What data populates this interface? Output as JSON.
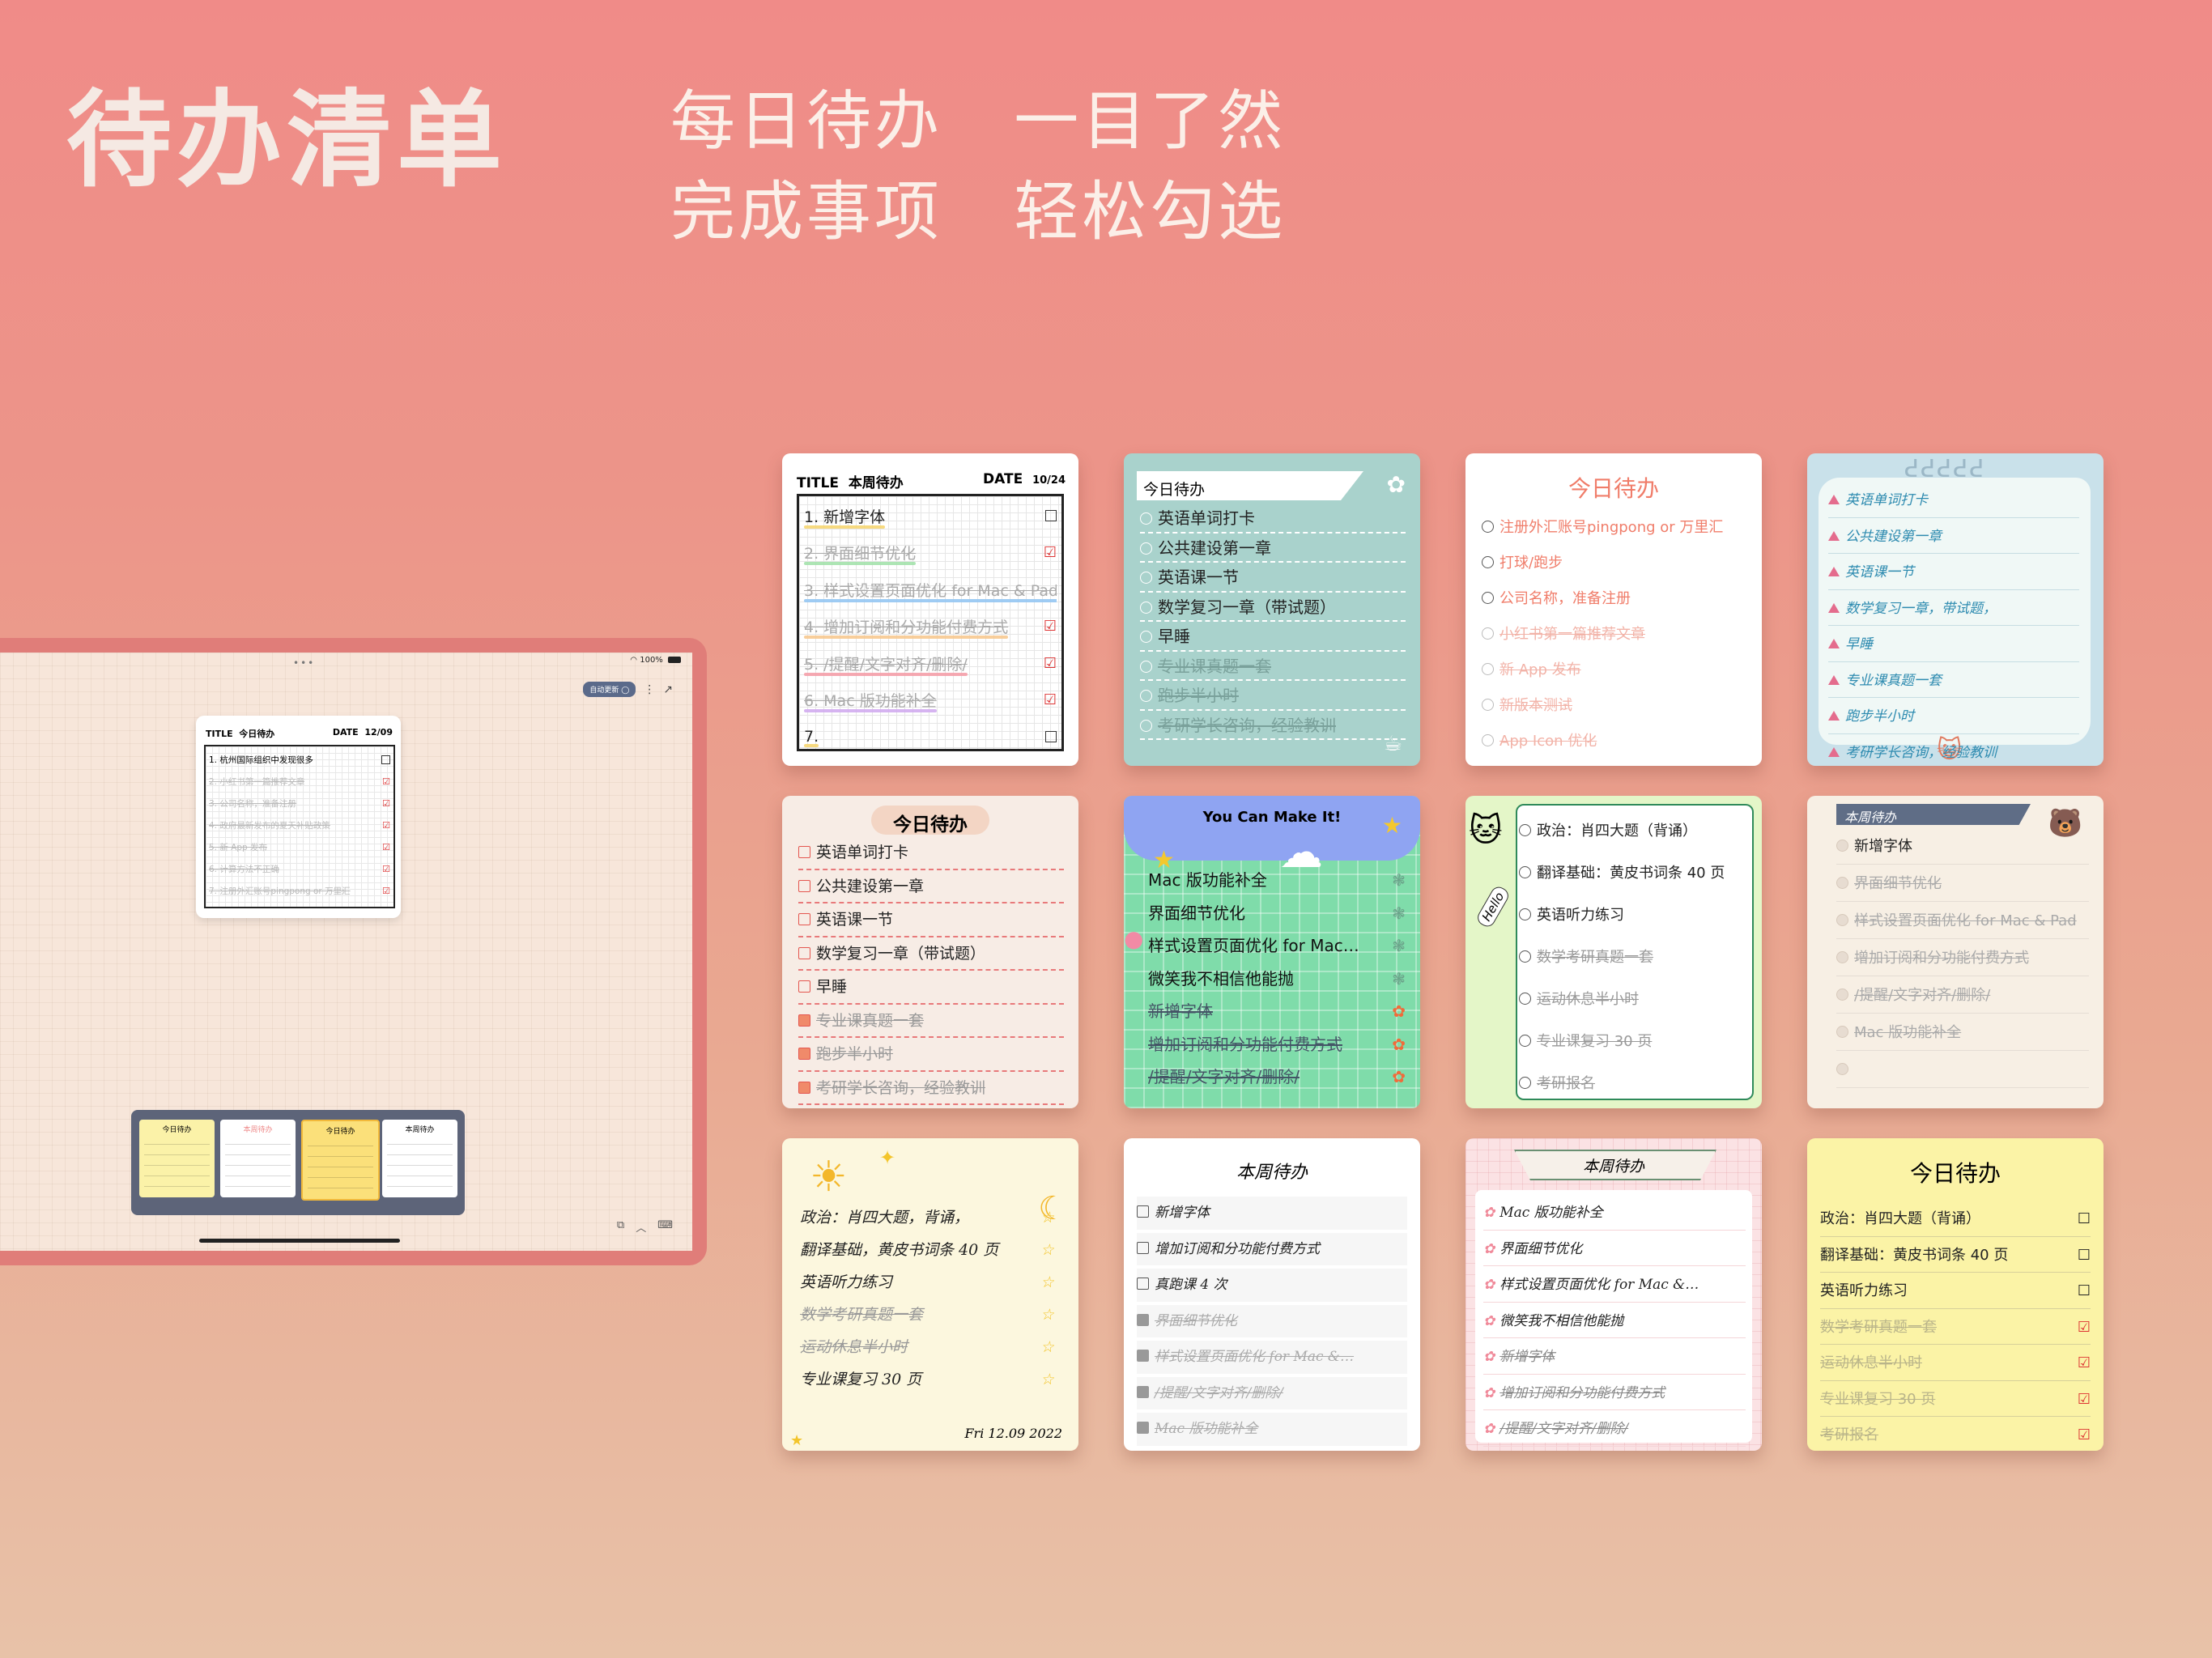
{
  "header": {
    "title": "待办清单",
    "slogan_line1": "每日待办   一目了然",
    "slogan_line2": "完成事项   轻松勾选"
  },
  "tablet": {
    "dots": "•••",
    "battery": "100%",
    "auto_update_label": "自动更新",
    "mini_note": {
      "title_label": "TITLE",
      "title": "今日待办",
      "date_label": "DATE",
      "date": "12/09",
      "items": [
        {
          "text": "1. 杭州国际组织中发现很多",
          "done": false
        },
        {
          "text": "2. 小红书第一篇推荐文章",
          "done": true
        },
        {
          "text": "3. 公司名称，准备注册",
          "done": true
        },
        {
          "text": "4. 政府最新发布的夏天补贴政策",
          "done": true
        },
        {
          "text": "5. 新 App 发布",
          "done": true
        },
        {
          "text": "6. 计算方法不正确",
          "done": true
        },
        {
          "text": "7. 注册外汇账号pingpong or 万里汇",
          "done": true
        }
      ]
    },
    "widget_titles": [
      "今日待办",
      "本周待办",
      "今日待办",
      "本周待办"
    ]
  },
  "cards": {
    "c1": {
      "title_label": "TITLE",
      "title": "本周待办",
      "date_label": "DATE",
      "date": "10/24",
      "items": [
        {
          "text": "1. 新增字体",
          "done": false,
          "hl": "#f6d36a"
        },
        {
          "text": "2. 界面细节优化",
          "done": true,
          "hl": "#9fe0a7"
        },
        {
          "text": "3. 样式设置页面优化 for Mac & Pad",
          "done": true,
          "hl": "#8ec3f2"
        },
        {
          "text": "4. 增加订阅和分功能付费方式",
          "done": true,
          "hl": "#f7c58a"
        },
        {
          "text": "5. /提醒/文字对齐/删除/",
          "done": true,
          "hl": "#f59aa5"
        },
        {
          "text": "6. Mac 版功能补全",
          "done": true,
          "hl": "#cfa7ee"
        },
        {
          "text": "7.",
          "done": false,
          "hl": "#f6d36a"
        }
      ]
    },
    "c2": {
      "title": "今日待办",
      "items": [
        {
          "text": "英语单词打卡",
          "done": false
        },
        {
          "text": "公共建设第一章",
          "done": false
        },
        {
          "text": "英语课一节",
          "done": false
        },
        {
          "text": "数学复习一章（带试题）",
          "done": false
        },
        {
          "text": "早睡",
          "done": false
        },
        {
          "text": "专业课真题一套",
          "done": true
        },
        {
          "text": "跑步半小时",
          "done": true
        },
        {
          "text": "考研学长咨询，经验教训",
          "done": true
        }
      ]
    },
    "c3": {
      "title": "今日待办",
      "items": [
        {
          "text": "注册外汇账号pingpong or 万里汇",
          "done": false
        },
        {
          "text": "打球/跑步",
          "done": false
        },
        {
          "text": "公司名称，准备注册",
          "done": false
        },
        {
          "text": "小红书第一篇推荐文章",
          "done": true
        },
        {
          "text": "新 App 发布",
          "done": true
        },
        {
          "text": "新版本测试",
          "done": true
        },
        {
          "text": "App Icon 优化",
          "done": true
        }
      ]
    },
    "c4": {
      "items": [
        {
          "text": "英语单词打卡",
          "done": false
        },
        {
          "text": "公共建设第一章",
          "done": false
        },
        {
          "text": "英语课一节",
          "done": false
        },
        {
          "text": "数学复习一章，带试题，",
          "done": false
        },
        {
          "text": "早睡",
          "done": false
        },
        {
          "text": "专业课真题一套",
          "done": false
        },
        {
          "text": "跑步半小时",
          "done": false
        },
        {
          "text": "考研学长咨询，经验教训",
          "done": false
        }
      ]
    },
    "c5": {
      "title": "今日待办",
      "items": [
        {
          "text": "英语单词打卡",
          "done": false
        },
        {
          "text": "公共建设第一章",
          "done": false
        },
        {
          "text": "英语课一节",
          "done": false
        },
        {
          "text": "数学复习一章（带试题）",
          "done": false
        },
        {
          "text": "早睡",
          "done": false
        },
        {
          "text": "专业课真题一套",
          "done": true
        },
        {
          "text": "跑步半小时",
          "done": true
        },
        {
          "text": "考研学长咨询，经验教训",
          "done": true
        }
      ]
    },
    "c6": {
      "title": "You Can Make It!",
      "items": [
        {
          "text": "Mac 版功能补全",
          "done": false
        },
        {
          "text": "界面细节优化",
          "done": false
        },
        {
          "text": "样式设置页面优化 for Mac…",
          "done": false
        },
        {
          "text": "微笑我不相信他能抛",
          "done": false
        },
        {
          "text": "新增字体",
          "done": true
        },
        {
          "text": "增加订阅和分功能付费方式",
          "done": true
        },
        {
          "text": "/提醒/文字对齐/删除/",
          "done": true
        }
      ]
    },
    "c7": {
      "hello": "Hello",
      "items": [
        {
          "text": "政治：肖四大题（背诵）",
          "done": false
        },
        {
          "text": "翻译基础：黄皮书词条 40 页",
          "done": false
        },
        {
          "text": "英语听力练习",
          "done": false
        },
        {
          "text": "数学考研真题一套",
          "done": true
        },
        {
          "text": "运动休息半小时",
          "done": true
        },
        {
          "text": "专业课复习 30 页",
          "done": true
        },
        {
          "text": "考研报名",
          "done": true
        }
      ]
    },
    "c8": {
      "title": "本周待办",
      "items": [
        {
          "text": "新增字体",
          "done": false
        },
        {
          "text": "界面细节优化",
          "done": true
        },
        {
          "text": "样式设置页面优化 for Mac & Pad",
          "done": true
        },
        {
          "text": "增加订阅和分功能付费方式",
          "done": true
        },
        {
          "text": "/提醒/文字对齐/删除/",
          "done": true
        },
        {
          "text": "Mac 版功能补全",
          "done": true
        },
        {
          "text": "",
          "done": false
        }
      ]
    },
    "c9": {
      "date": "Fri 12.09 2022",
      "items": [
        {
          "text": "政治：肖四大题，背诵，",
          "done": false
        },
        {
          "text": "翻译基础，黄皮书词条 40 页",
          "done": false
        },
        {
          "text": "英语听力练习",
          "done": false
        },
        {
          "text": "数学考研真题一套",
          "done": true
        },
        {
          "text": "运动休息半小时",
          "done": true
        },
        {
          "text": "专业课复习 30 页",
          "done": false
        }
      ]
    },
    "c10": {
      "title": "本周待办",
      "items": [
        {
          "text": "新增字体",
          "done": false
        },
        {
          "text": "增加订阅和分功能付费方式",
          "done": false
        },
        {
          "text": "真跑课 4 次",
          "done": false
        },
        {
          "text": "界面细节优化",
          "done": true
        },
        {
          "text": "样式设置页面优化 for Mac &…",
          "done": true
        },
        {
          "text": "/提醒/文字对齐/删除/",
          "done": true
        },
        {
          "text": "Mac 版功能补全",
          "done": true
        }
      ]
    },
    "c11": {
      "title": "本周待办",
      "items": [
        {
          "text": "Mac 版功能补全",
          "done": false
        },
        {
          "text": "界面细节优化",
          "done": false
        },
        {
          "text": "样式设置页面优化 for Mac &…",
          "done": false
        },
        {
          "text": "微笑我不相信他能抛",
          "done": false
        },
        {
          "text": "新增字体",
          "done": true
        },
        {
          "text": "增加订阅和分功能付费方式",
          "done": true
        },
        {
          "text": "/提醒/文字对齐/删除/",
          "done": true
        }
      ]
    },
    "c12": {
      "title": "今日待办",
      "items": [
        {
          "text": "政治：肖四大题（背诵）",
          "done": false
        },
        {
          "text": "翻译基础：黄皮书词条 40 页",
          "done": false
        },
        {
          "text": "英语听力练习",
          "done": false
        },
        {
          "text": "数学考研真题一套",
          "done": true
        },
        {
          "text": "运动休息半小时",
          "done": true
        },
        {
          "text": "专业课复习 30 页",
          "done": true
        },
        {
          "text": "考研报名",
          "done": true
        }
      ]
    }
  },
  "colors": {
    "accent": "#f08b88",
    "check_red": "#d33333",
    "c3_title": "#f07d6a"
  }
}
